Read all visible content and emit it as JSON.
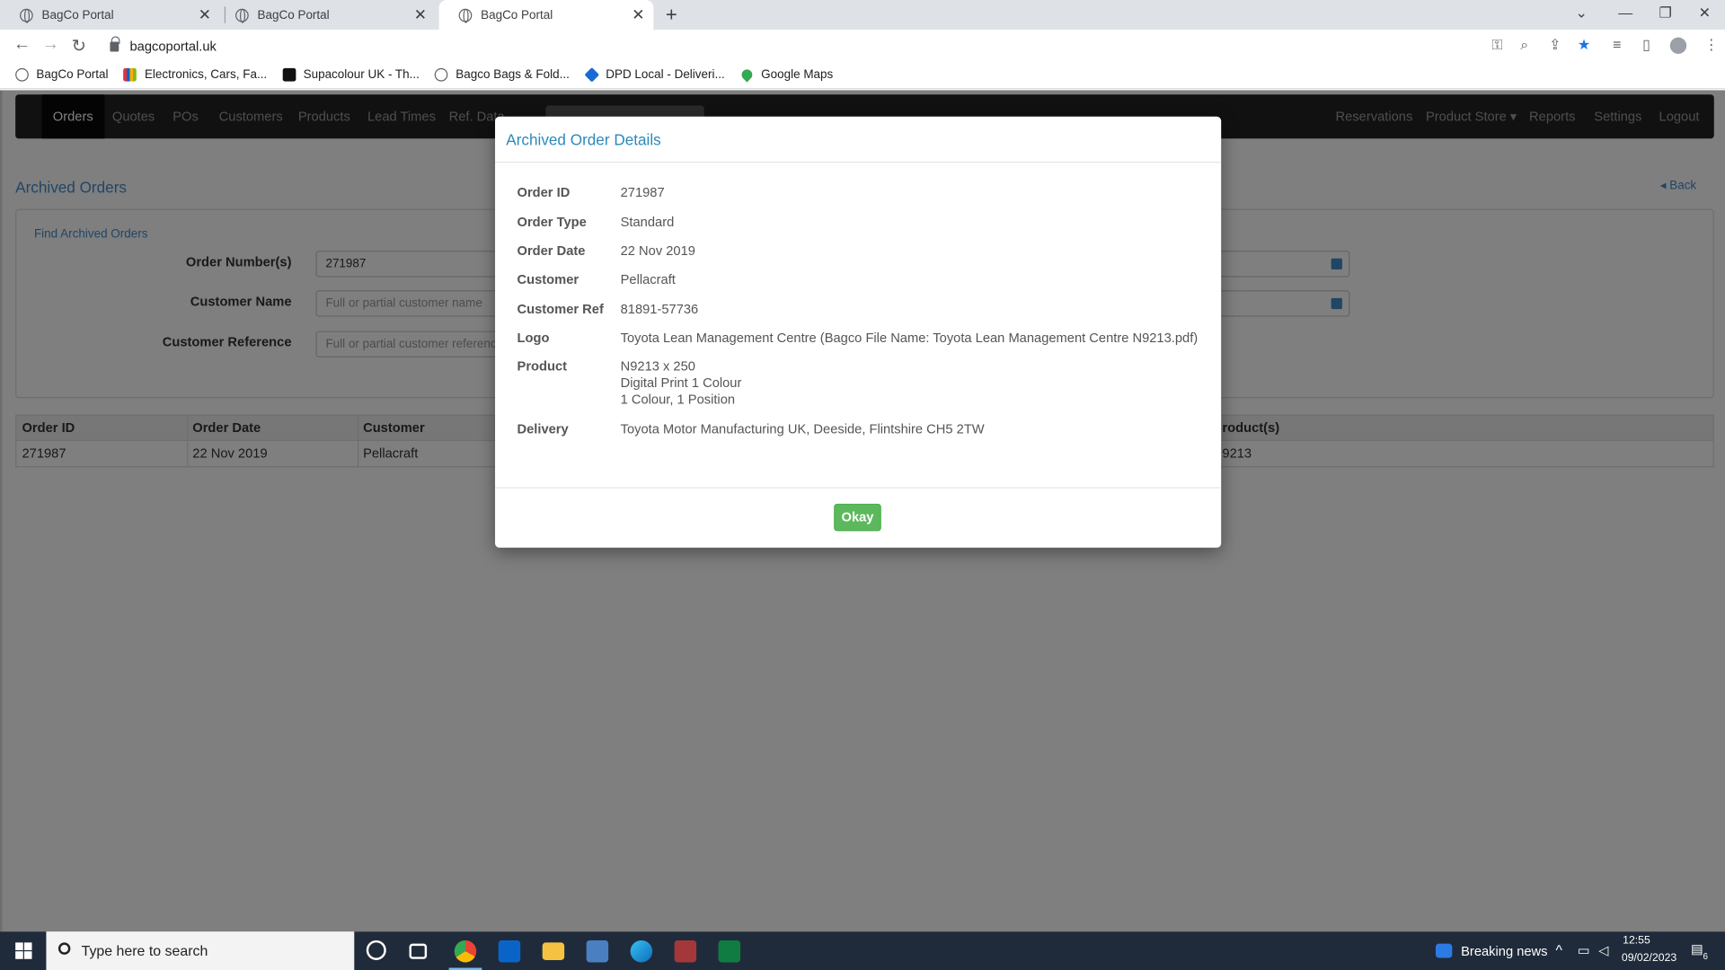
{
  "browser": {
    "tabs": [
      {
        "title": "BagCo Portal",
        "active": false
      },
      {
        "title": "BagCo Portal",
        "active": false
      },
      {
        "title": "BagCo Portal",
        "active": true
      }
    ],
    "url": "bagcoportal.uk",
    "bookmarks": [
      {
        "label": "BagCo Portal",
        "icon": "globe-icon"
      },
      {
        "label": "Electronics, Cars, Fa...",
        "icon": "ebay-icon"
      },
      {
        "label": "Supacolour UK - Th...",
        "icon": "supacolour-icon"
      },
      {
        "label": "Bagco Bags & Fold...",
        "icon": "globe-icon"
      },
      {
        "label": "DPD Local - Deliveri...",
        "icon": "dpd-icon"
      },
      {
        "label": "Google Maps",
        "icon": "maps-pin-icon"
      }
    ]
  },
  "nav": {
    "left": [
      "Orders",
      "Quotes",
      "POs",
      "Customers",
      "Products",
      "Lead Times",
      "Ref. Data"
    ],
    "right": [
      "Reservations",
      "Product Store ▾",
      "Reports",
      "Settings",
      "Logout"
    ],
    "active": "Orders"
  },
  "page": {
    "title": "Archived Orders",
    "back": "Back",
    "panel_title": "Find Archived Orders",
    "form": {
      "order_numbers_label": "Order Number(s)",
      "order_numbers_value": "271987",
      "customer_name_label": "Customer Name",
      "customer_name_placeholder": "Full or partial customer name",
      "customer_ref_label": "Customer Reference",
      "customer_ref_placeholder": "Full or partial customer reference"
    },
    "table": {
      "headers": [
        "Order ID",
        "Order Date",
        "Customer",
        "roduct(s)"
      ],
      "rows": [
        [
          "271987",
          "22 Nov 2019",
          "Pellacraft",
          "9213"
        ]
      ]
    }
  },
  "modal": {
    "title": "Archived Order Details",
    "fields": [
      {
        "label": "Order ID",
        "value": "271987"
      },
      {
        "label": "Order Type",
        "value": "Standard"
      },
      {
        "label": "Order Date",
        "value": "22 Nov 2019"
      },
      {
        "label": "Customer",
        "value": "Pellacraft"
      },
      {
        "label": "Customer Ref",
        "value": "81891-57736"
      },
      {
        "label": "Logo",
        "value": "Toyota Lean Management Centre (Bagco File Name: Toyota Lean Management Centre N9213.pdf)"
      },
      {
        "label": "Product",
        "lines": [
          "N9213 x 250",
          "Digital Print 1 Colour",
          "1 Colour, 1 Position"
        ]
      },
      {
        "label": "Delivery",
        "value": "Toyota Motor Manufacturing UK, Deeside, Flintshire CH5 2TW"
      }
    ],
    "ok_label": "Okay"
  },
  "taskbar": {
    "search_placeholder": "Type here to search",
    "news": "Breaking news",
    "time": "12:55",
    "date": "09/02/2023",
    "notif_count": "6"
  },
  "colors": {
    "accent": "#428bca",
    "ok_green": "#5cb85c",
    "navbar": "#222222"
  }
}
